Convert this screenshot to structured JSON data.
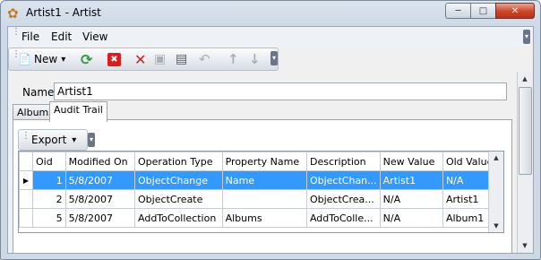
{
  "window": {
    "title": "Artist1 - Artist",
    "icon": "flower-icon",
    "controls": {
      "minimize": "─",
      "maximize": "□",
      "close": "✕"
    }
  },
  "menu": {
    "items": [
      "File",
      "Edit",
      "View"
    ]
  },
  "toolbar": {
    "new_label": "New",
    "new_dropdown": "▾",
    "icons": {
      "new": "📄",
      "refresh": "⟳",
      "close_doc": "✖",
      "delete": "✕",
      "save": "▣",
      "save_all": "▤",
      "undo": "↶",
      "up": "↑",
      "down": "↓"
    }
  },
  "form": {
    "name_label": "Name",
    "name_value": "Artist1"
  },
  "tabs": [
    {
      "label": "Albums",
      "active": false
    },
    {
      "label": "Audit Trail",
      "active": true
    }
  ],
  "export": {
    "label": "Export",
    "dropdown": "▾"
  },
  "grid": {
    "columns": [
      "Oid",
      "Modified On",
      "Operation Type",
      "Property Name",
      "Description",
      "New Value",
      "Old Value"
    ],
    "rows": [
      {
        "selected": true,
        "cells": [
          "1",
          "5/8/2007",
          "ObjectChange",
          "Name",
          "ObjectChange",
          "Artist1",
          "N/A"
        ],
        "display_desc": "ObjectChan..."
      },
      {
        "selected": false,
        "cells": [
          "2",
          "5/8/2007",
          "ObjectCreate",
          "",
          "ObjectCreate",
          "N/A",
          "Artist1"
        ],
        "display_desc": "ObjectCrea..."
      },
      {
        "selected": false,
        "cells": [
          "5",
          "5/8/2007",
          "AddToCollection",
          "Albums",
          "AddToCollection",
          "N/A",
          "Album1"
        ],
        "display_desc": "AddToColle..."
      }
    ],
    "current_row_marker": "▶"
  },
  "colors": {
    "selection": "#3399ff",
    "close_button": "#c8462d",
    "refresh_icon": "#2f9a3a",
    "delete_icon": "#d42020"
  }
}
